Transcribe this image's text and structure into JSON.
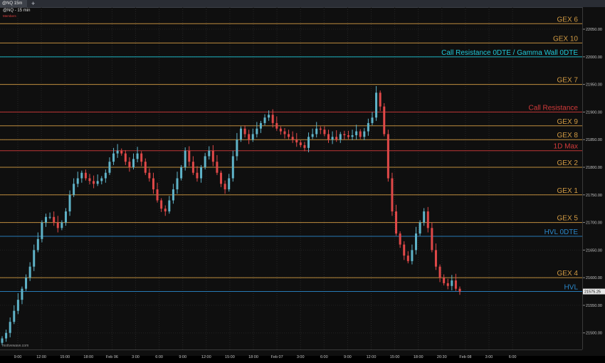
{
  "tab": {
    "label": "@NQ 15m",
    "add_label": "+"
  },
  "header": {
    "title": "@NQ - 15 min",
    "study": "Members"
  },
  "watermark": "motivewave.com",
  "colors": {
    "background": "#0f0f0f",
    "up_candle": "#5fb3c8",
    "down_candle": "#e04848",
    "gex": "#d19a43",
    "call_resistance": "#d23a3a",
    "gamma_wall": "#1fc8d8",
    "hvl": "#2a86c8"
  },
  "chart_data": {
    "type": "candlestick",
    "title": "@NQ - 15 min",
    "ylim": [
      21470,
      22090
    ],
    "y_ticks": [
      21500,
      21550,
      21600,
      21650,
      21700,
      21750,
      21800,
      21850,
      21900,
      21950,
      22000,
      22050
    ],
    "x_ticks": [
      "9:00",
      "12:00",
      "15:00",
      "18:00",
      "Feb 06",
      "3:00",
      "6:00",
      "9:00",
      "12:00",
      "15:00",
      "18:00",
      "Feb 07",
      "3:00",
      "6:00",
      "9:00",
      "12:00",
      "15:00",
      "18:00",
      "20:30",
      "Feb 08",
      "3:00",
      "6:00"
    ],
    "current_price": {
      "value": 21575,
      "label": "21575.25"
    },
    "levels": [
      {
        "name": "GEX 6",
        "value": 22060,
        "type": "gex"
      },
      {
        "name": "GEX 10",
        "value": 22025,
        "type": "gex"
      },
      {
        "name": "Call Resistance 0DTE / Gamma Wall 0DTE",
        "value": 22000,
        "type": "gamma_wall"
      },
      {
        "name": "GEX 7",
        "value": 21950,
        "type": "gex"
      },
      {
        "name": "Call Resistance",
        "value": 21900,
        "type": "call_resistance"
      },
      {
        "name": "GEX 9",
        "value": 21875,
        "type": "gex"
      },
      {
        "name": "GEX 8",
        "value": 21850,
        "type": "gex"
      },
      {
        "name": "1D Max",
        "value": 21830,
        "type": "call_resistance"
      },
      {
        "name": "GEX 2",
        "value": 21800,
        "type": "gex"
      },
      {
        "name": "GEX 1",
        "value": 21750,
        "type": "gex"
      },
      {
        "name": "GEX 5",
        "value": 21700,
        "type": "gex"
      },
      {
        "name": "HVL 0DTE",
        "value": 21675,
        "type": "hvl"
      },
      {
        "name": "GEX 4",
        "value": 21600,
        "type": "gex"
      },
      {
        "name": "HVL",
        "value": 21575,
        "type": "hvl"
      }
    ],
    "price_path": [
      [
        21490,
        21500,
        21520,
        21540,
        21560,
        21580,
        21600,
        21620,
        21650,
        21670,
        21700,
        21710,
        21710
      ],
      [
        21700,
        21690,
        21700,
        21720,
        21750,
        21770,
        21780,
        21790,
        21780,
        21775,
        21770,
        21775,
        21780
      ],
      [
        21790,
        21810,
        21825,
        21830,
        21825,
        21810,
        21800,
        21815,
        21825,
        21810,
        21790,
        21780,
        21760
      ],
      [
        21740,
        21725,
        21720,
        21740,
        21760,
        21780,
        21800,
        21830,
        21810,
        21790,
        21780,
        21800,
        21820
      ],
      [
        21830,
        21810,
        21790,
        21770,
        21760,
        21780,
        21820,
        21850,
        21870,
        21860,
        21850,
        21860,
        21870
      ],
      [
        21880,
        21890,
        21895,
        21880,
        21870,
        21865,
        21860,
        21855,
        21850,
        21845,
        21840,
        21835,
        21855
      ],
      [
        21860,
        21870,
        21868,
        21860,
        21850,
        21855,
        21850,
        21860,
        21858,
        21855,
        21858,
        21865,
        21855
      ],
      [
        21865,
        21880,
        21890,
        21935,
        21910,
        21860,
        21780,
        21720,
        21680,
        21660,
        21640,
        21630,
        21650
      ],
      [
        21680,
        21700,
        21720,
        21690,
        21650,
        21620,
        21600,
        21590,
        21585,
        21595,
        21580,
        21575
      ]
    ]
  }
}
